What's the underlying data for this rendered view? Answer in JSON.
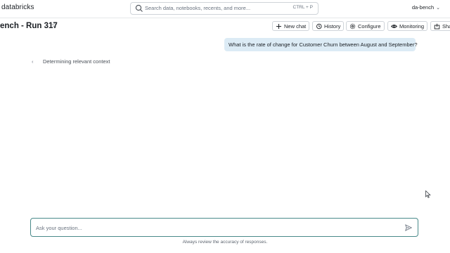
{
  "topbar": {
    "logo": "databricks",
    "search_placeholder": "Search data, notebooks, recents, and more...",
    "search_shortcut": "CTRL + P",
    "user": "da-bench"
  },
  "header": {
    "title": "ench - Run 317",
    "buttons": {
      "new_chat": "New chat",
      "history": "History",
      "configure": "Configure",
      "monitoring": "Monitoring",
      "share": "Sha"
    }
  },
  "chat": {
    "user_message": "What is the rate of change for Customer Churn between August and September?",
    "status": "Determining relevant context"
  },
  "composer": {
    "placeholder": "Ask your question...",
    "disclaimer": "Always review the accuracy of responses."
  }
}
